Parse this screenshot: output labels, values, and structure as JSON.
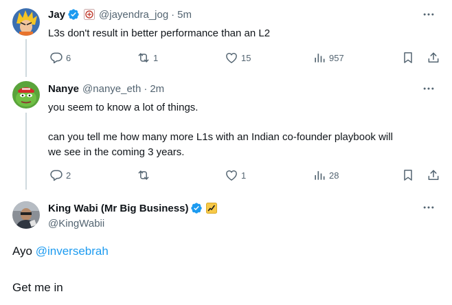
{
  "colors": {
    "link": "#1d9bf0",
    "verified": "#1d9bf0",
    "text": "#0f1419",
    "secondary": "#536471"
  },
  "tweets": [
    {
      "name": "Jay",
      "handle": "@jayendra_jog",
      "time": "5m",
      "text": "L3s don't result in better performance than an L2",
      "replies": "6",
      "reposts": "1",
      "likes": "15",
      "views": "957"
    },
    {
      "name": "Nanye",
      "handle": "@nanye_eth",
      "time": "2m",
      "text_line1": "you seem to know a lot of things.",
      "text_line2": "can you tell me how many more L1s with an Indian co-founder playbook will",
      "text_line3": "we see in the coming 3 years.",
      "replies": "2",
      "reposts": "",
      "likes": "1",
      "views": "28"
    },
    {
      "name": "King Wabi (Mr Big Business)",
      "handle": "@KingWabii",
      "text_prefix": "Ayo ",
      "mention": "@inversebrah",
      "text_line2": "Get me in"
    }
  ]
}
